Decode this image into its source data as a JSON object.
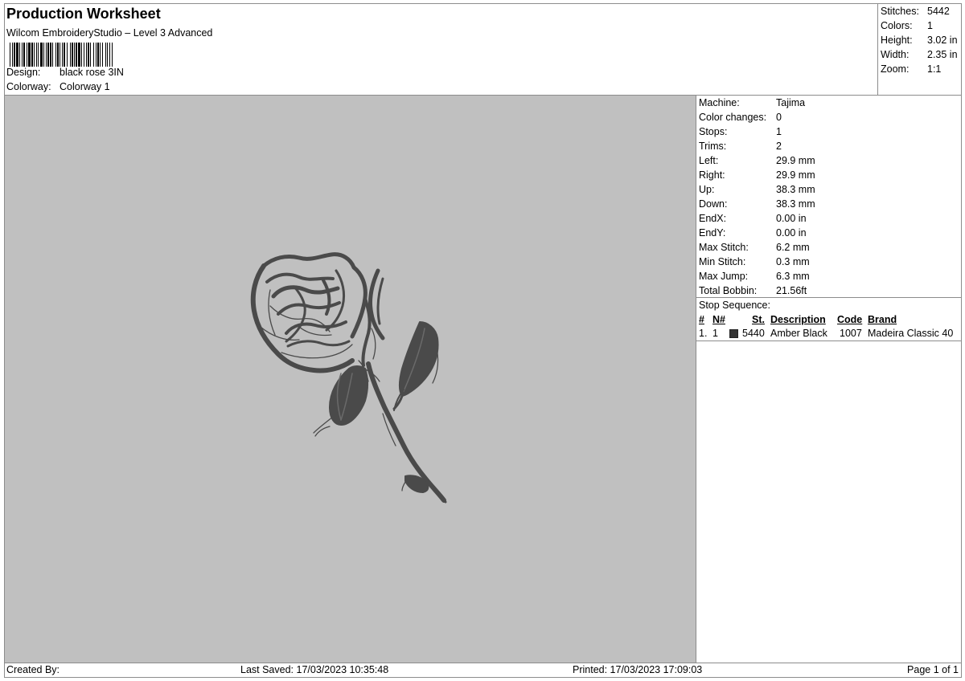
{
  "header": {
    "title": "Production Worksheet",
    "software": "Wilcom EmbroideryStudio – Level 3 Advanced",
    "design_label": "Design:",
    "design_value": "black rose 3IN",
    "colorway_label": "Colorway:",
    "colorway_value": "Colorway 1"
  },
  "stats": [
    {
      "label": "Stitches:",
      "value": "5442"
    },
    {
      "label": "Colors:",
      "value": "1"
    },
    {
      "label": "Height:",
      "value": "3.02 in"
    },
    {
      "label": "Width:",
      "value": "2.35 in"
    },
    {
      "label": "Zoom:",
      "value": "1:1"
    }
  ],
  "machine_info": [
    {
      "label": "Machine:",
      "value": "Tajima"
    },
    {
      "label": "Color changes:",
      "value": "0"
    },
    {
      "label": "Stops:",
      "value": "1"
    },
    {
      "label": "Trims:",
      "value": "2"
    },
    {
      "label": "Left:",
      "value": "29.9 mm"
    },
    {
      "label": "Right:",
      "value": "29.9 mm"
    },
    {
      "label": "Up:",
      "value": "38.3 mm"
    },
    {
      "label": "Down:",
      "value": "38.3 mm"
    },
    {
      "label": "EndX:",
      "value": "0.00 in"
    },
    {
      "label": "EndY:",
      "value": "0.00 in"
    },
    {
      "label": "Max Stitch:",
      "value": "6.2 mm"
    },
    {
      "label": "Min Stitch:",
      "value": "0.3 mm"
    },
    {
      "label": "Max Jump:",
      "value": "6.3 mm"
    },
    {
      "label": "Total Bobbin:",
      "value": "21.56ft"
    }
  ],
  "stop_sequence": {
    "title": "Stop Sequence:",
    "headers": {
      "index": "#",
      "needle": "N#",
      "stitches": "St.",
      "description": "Description",
      "code": "Code",
      "brand": "Brand"
    },
    "rows": [
      {
        "index": "1.",
        "needle": "1",
        "stitches": "5440",
        "description": "Amber Black",
        "code": "1007",
        "brand": "Madeira Classic 40",
        "swatch_color": "#333333"
      }
    ]
  },
  "footer": {
    "created_by": "Created By:",
    "last_saved": "Last Saved: 17/03/2023 10:35:48",
    "printed": "Printed: 17/03/2023 17:09:03",
    "page": "Page 1 of 1"
  },
  "colors": {
    "preview_background": "#c0c0c0",
    "thread": "#4a4a4a"
  }
}
